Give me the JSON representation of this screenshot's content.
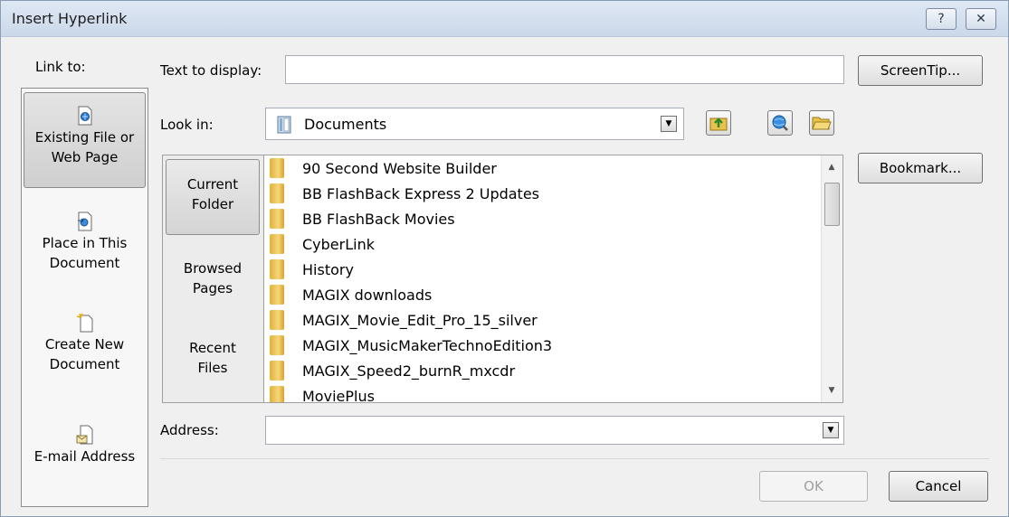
{
  "window": {
    "title": "Insert Hyperlink",
    "help_glyph": "?",
    "close_glyph": "✕"
  },
  "link_to": {
    "label": "Link to:",
    "items": [
      {
        "line1": "Existing File or",
        "line2": "Web Page",
        "icon": "existing-file-icon",
        "selected": true
      },
      {
        "line1": "Place in This",
        "line2": "Document",
        "icon": "place-in-document-icon",
        "selected": false
      },
      {
        "line1": "Create New",
        "line2": "Document",
        "icon": "create-new-document-icon",
        "selected": false
      },
      {
        "line1": "E-mail Address",
        "line2": "",
        "icon": "email-address-icon",
        "selected": false
      }
    ]
  },
  "text_to_display": {
    "label": "Text to display:",
    "value": ""
  },
  "screentip_button": "ScreenTip...",
  "look_in": {
    "label": "Look in:",
    "value": "Documents"
  },
  "places": [
    {
      "line1": "Current",
      "line2": "Folder",
      "selected": true
    },
    {
      "line1": "Browsed",
      "line2": "Pages",
      "selected": false
    },
    {
      "line1": "Recent",
      "line2": "Files",
      "selected": false
    }
  ],
  "files": [
    "90 Second Website Builder",
    "BB FlashBack Express 2 Updates",
    "BB FlashBack Movies",
    "CyberLink",
    "History",
    "MAGIX downloads",
    "MAGIX_Movie_Edit_Pro_15_silver",
    "MAGIX_MusicMakerTechnoEdition3",
    "MAGIX_Speed2_burnR_mxcdr",
    "MoviePlus"
  ],
  "bookmark_button": "Bookmark...",
  "address": {
    "label": "Address:",
    "value": ""
  },
  "ok_button": "OK",
  "cancel_button": "Cancel",
  "colors": {
    "dialog_bg": "#f0f0f0",
    "title_bg": "#dfe8f4",
    "folder": "#e8b84a"
  }
}
